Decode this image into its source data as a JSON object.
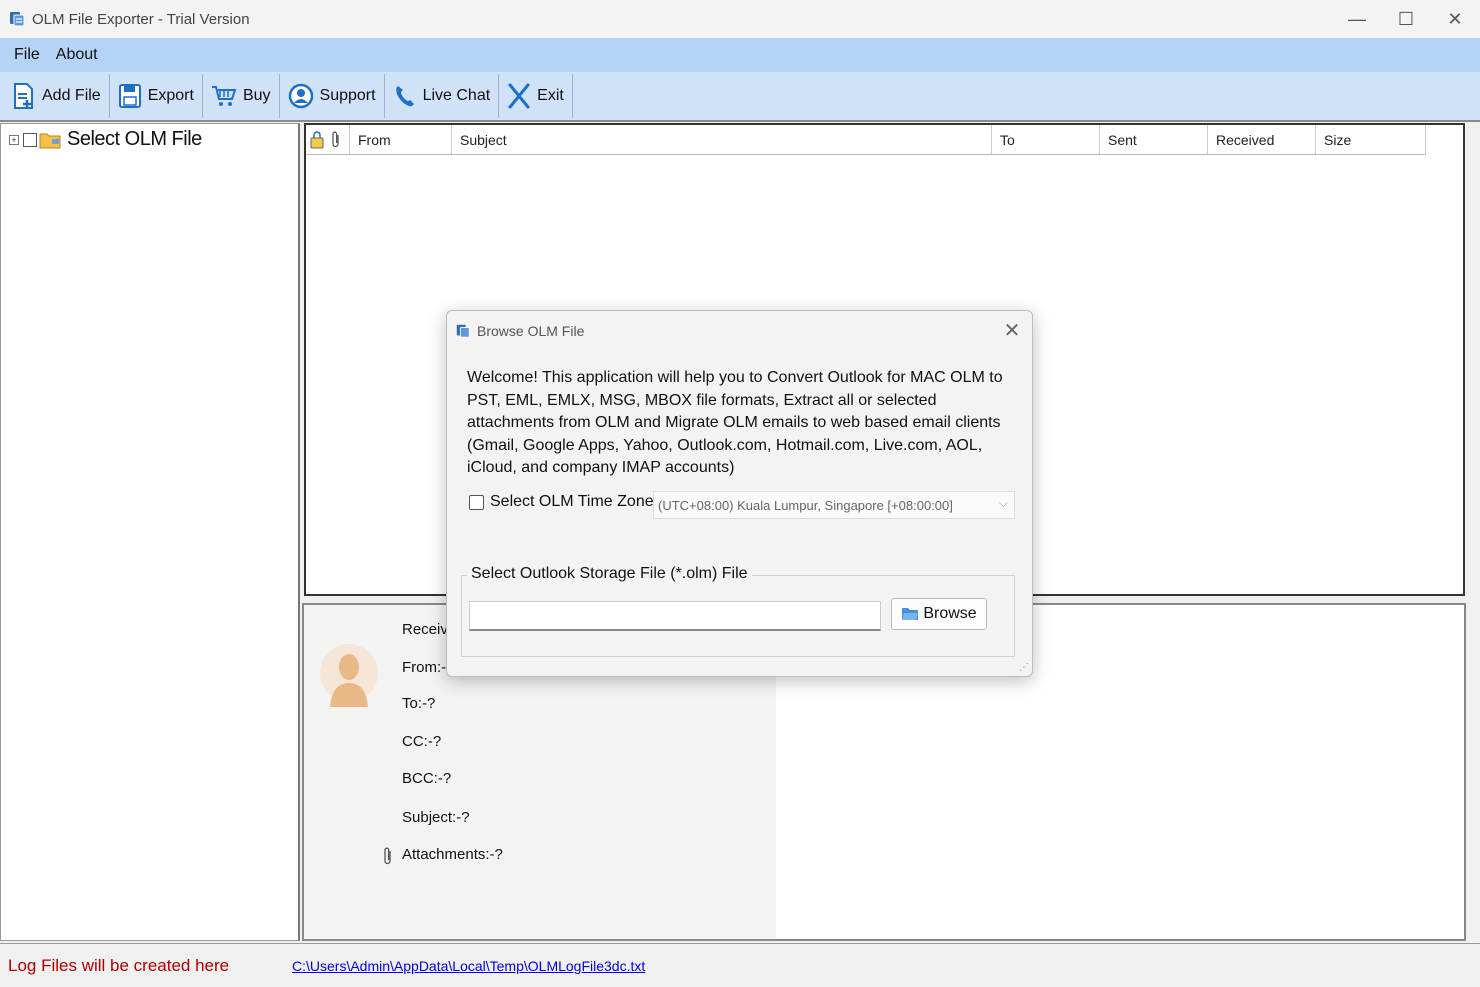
{
  "window": {
    "title": "OLM File Exporter - Trial Version",
    "controls": {
      "minimize": "—",
      "maximize": "☐",
      "close": "✕"
    }
  },
  "menu": [
    {
      "label": "File"
    },
    {
      "label": "About"
    }
  ],
  "toolbar": {
    "add_file": "Add File",
    "export": "Export",
    "buy": "Buy",
    "support": "Support",
    "live_chat": "Live Chat",
    "exit": "Exit"
  },
  "tree": {
    "root_label": "Select OLM File",
    "expander": "+"
  },
  "grid": {
    "columns": [
      "From",
      "Subject",
      "To",
      "Sent",
      "Received",
      "Size"
    ]
  },
  "preview": {
    "received": "Receive",
    "from": "From:-?",
    "to": "To:-?",
    "cc": "CC:-?",
    "bcc": "BCC:-?",
    "subject": "Subject:-?",
    "attachments": "Attachments:-?"
  },
  "statusbar": {
    "log_label": "Log Files will be created here",
    "log_path": "C:\\Users\\Admin\\AppData\\Local\\Temp\\OLMLogFile3dc.txt"
  },
  "dialog": {
    "title": "Browse OLM File",
    "welcome_text": "Welcome! This application will help you to Convert Outlook for MAC OLM to PST, EML, EMLX, MSG, MBOX file formats, Extract all or selected attachments from OLM and Migrate OLM emails to web based email clients (Gmail, Google Apps, Yahoo, Outlook.com, Hotmail.com, Live.com, AOL, iCloud, and company IMAP accounts)",
    "timezone_checkbox_label": "Select OLM Time Zone",
    "timezone_checked": false,
    "timezone_value": "(UTC+08:00) Kuala Lumpur, Singapore  [+08:00:00]",
    "storage_group_title": "Select Outlook Storage File (*.olm) File",
    "path_value": "",
    "browse_label": "Browse"
  },
  "colors": {
    "menubar": "#b4d3f5",
    "toolbar": "#cfe2f8",
    "log_label": "#b00000",
    "link": "#0000ee",
    "icon_blue": "#1e6fc9"
  }
}
